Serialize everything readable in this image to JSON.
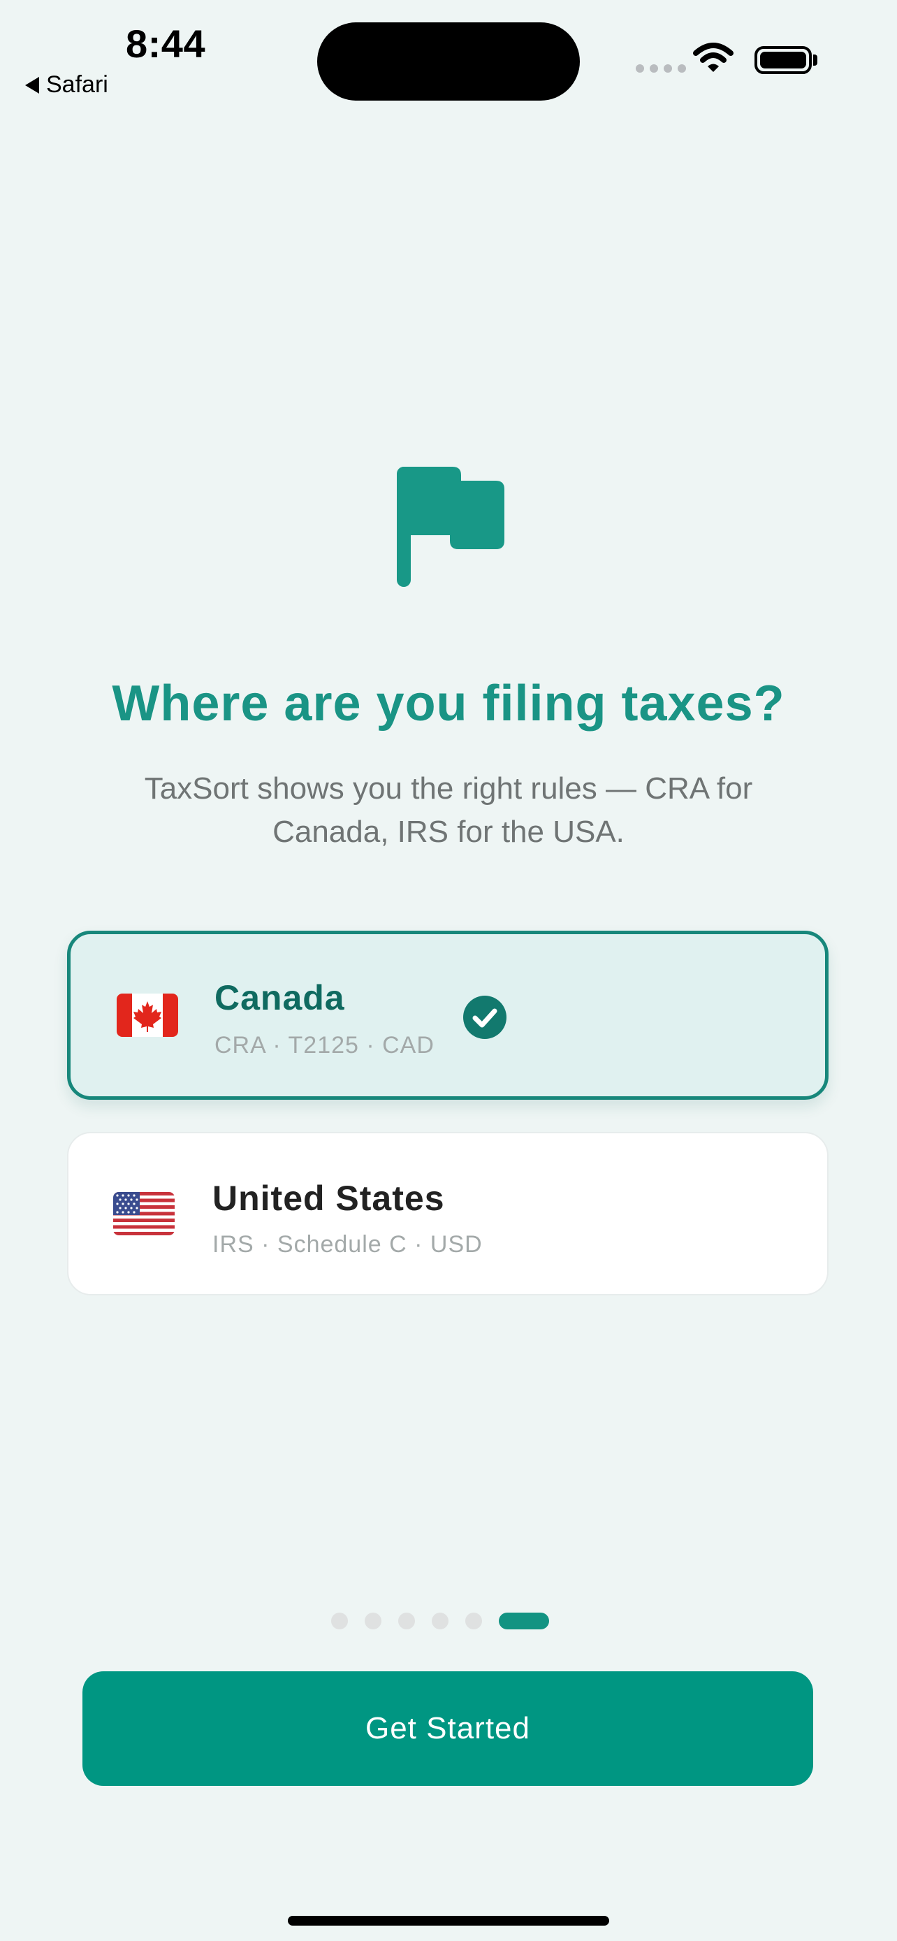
{
  "status_bar": {
    "time": "8:44",
    "back_label": "Safari"
  },
  "hero": {
    "icon": "flag-icon",
    "title": "Where are you filing taxes?",
    "subtitle": "TaxSort shows you the right rules — CRA for Canada, IRS for the USA."
  },
  "countries": [
    {
      "name": "Canada",
      "details": "CRA · T2125 · CAD",
      "flag_icon": "canada-flag-icon",
      "selected": true
    },
    {
      "name": "United States",
      "details": "IRS · Schedule C · USD",
      "flag_icon": "usa-flag-icon",
      "selected": false
    }
  ],
  "pager": {
    "total": 6,
    "current": 6
  },
  "cta": {
    "label": "Get Started"
  },
  "colors": {
    "accent": "#009682",
    "title": "#1a9485",
    "background": "#eef5f4",
    "selected_card_bg": "#e0f1f0",
    "selected_card_border": "#17877b"
  }
}
